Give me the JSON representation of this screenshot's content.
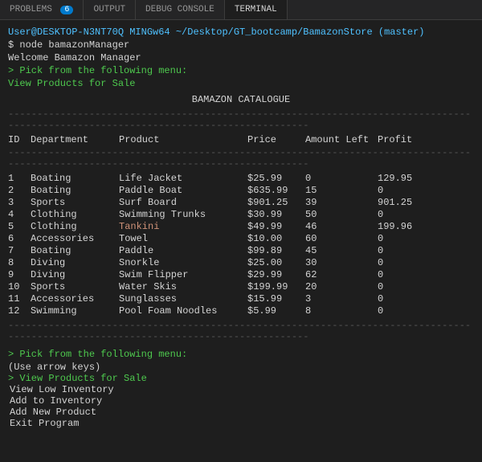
{
  "tabs": [
    {
      "label": "PROBLEMS",
      "badge": "6",
      "active": false
    },
    {
      "label": "OUTPUT",
      "badge": null,
      "active": false
    },
    {
      "label": "DEBUG CONSOLE",
      "badge": null,
      "active": false
    },
    {
      "label": "TERMINAL",
      "badge": null,
      "active": true
    }
  ],
  "terminal": {
    "user_line": "User@DESKTOP-N3NT70Q MINGw64 ~/Desktop/GT_bootcamp/BamazonStore (master)",
    "command": "$ node bamazonManager",
    "welcome": "Welcome Bamazon Manager",
    "menu_prompt_1": "> Pick from the following menu:",
    "menu_link": "View Products for Sale",
    "catalogue_title": "BAMAZON CATALOGUE",
    "divider": "------------------------------------------------------------------------------------------------------------------------------------",
    "headers": {
      "id": "ID",
      "department": "Department",
      "product": "Product",
      "price": "Price",
      "amount": "Amount Left",
      "profit": "Profit"
    },
    "products": [
      {
        "id": "1",
        "dept": "Boating",
        "product": "Life Jacket",
        "price": "$25.99",
        "amount": "0",
        "profit": "129.95"
      },
      {
        "id": "2",
        "dept": "Boating",
        "product": "Paddle Boat",
        "price": "$635.99",
        "amount": "15",
        "profit": "0"
      },
      {
        "id": "3",
        "dept": "Sports",
        "product": "Surf Board",
        "price": "$901.25",
        "amount": "39",
        "profit": "901.25"
      },
      {
        "id": "4",
        "dept": "Clothing",
        "product": "Swimming Trunks",
        "price": "$30.99",
        "amount": "50",
        "profit": "0"
      },
      {
        "id": "5",
        "dept": "Clothing",
        "product": "Tankini",
        "price": "$49.99",
        "amount": "46",
        "profit": "199.96"
      },
      {
        "id": "6",
        "dept": "Accessories",
        "product": "Towel",
        "price": "$10.00",
        "amount": "60",
        "profit": "0"
      },
      {
        "id": "7",
        "dept": "Boating",
        "product": "Paddle",
        "price": "$99.89",
        "amount": "45",
        "profit": "0"
      },
      {
        "id": "8",
        "dept": "Diving",
        "product": "Snorkle",
        "price": "$25.00",
        "amount": "30",
        "profit": "0"
      },
      {
        "id": "9",
        "dept": "Diving",
        "product": "Swim Flipper",
        "price": "$29.99",
        "amount": "62",
        "profit": "0"
      },
      {
        "id": "10",
        "dept": "Sports",
        "product": "Water Skis",
        "price": "$199.99",
        "amount": "20",
        "profit": "0"
      },
      {
        "id": "11",
        "dept": "Accessories",
        "product": "Sunglasses",
        "price": "$15.99",
        "amount": "3",
        "profit": "0"
      },
      {
        "id": "12",
        "dept": "Swimming",
        "product": "Pool Foam Noodles",
        "price": "$5.99",
        "amount": "8",
        "profit": "0"
      }
    ],
    "bottom_menu_prompt": "> Pick from the following menu:",
    "bottom_arrow_keys": "(Use arrow keys)",
    "bottom_selected": "> View Products for Sale",
    "bottom_items": [
      "View Low Inventory",
      "Add to Inventory",
      "Add New Product",
      "Exit Program"
    ]
  }
}
